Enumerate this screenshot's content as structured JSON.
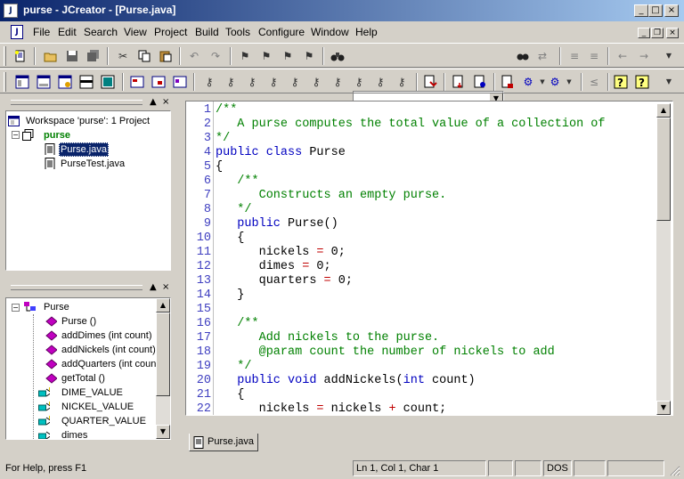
{
  "window": {
    "title": "purse - JCreator - [Purse.java]",
    "app_icon": "J",
    "buttons": {
      "minimize": "_",
      "maximize": "□",
      "close": "×"
    }
  },
  "menu": {
    "doc_icon": "J",
    "items": [
      "File",
      "Edit",
      "Search",
      "View",
      "Project",
      "Build",
      "Tools",
      "Configure",
      "Window",
      "Help"
    ],
    "mdi_buttons": {
      "minimize": "_",
      "restore": "❐",
      "close": "×"
    }
  },
  "toolbar": {
    "find_value": ""
  },
  "workspace_pane": {
    "close": "×",
    "pin": "▲",
    "items": [
      {
        "label": "Workspace 'purse': 1 Project",
        "icon": "workspace-icon"
      },
      {
        "label": "purse",
        "icon": "project-icon",
        "expander": "−"
      },
      {
        "label": "Purse.java",
        "icon": "java-file-icon"
      },
      {
        "label": "PurseTest.java",
        "icon": "java-file-icon"
      }
    ]
  },
  "class_pane": {
    "close": "×",
    "pin": "▲",
    "items": [
      {
        "label": "Purse",
        "icon": "class-icon",
        "expander": "−"
      },
      {
        "label": "Purse ()",
        "icon": "method-icon"
      },
      {
        "label": "addDimes (int count)",
        "icon": "method-icon"
      },
      {
        "label": "addNickels (int count)",
        "icon": "method-icon"
      },
      {
        "label": "addQuarters (int count",
        "icon": "method-icon"
      },
      {
        "label": "getTotal ()",
        "icon": "method-icon"
      },
      {
        "label": "DIME_VALUE",
        "icon": "field-icon"
      },
      {
        "label": "NICKEL_VALUE",
        "icon": "field-icon"
      },
      {
        "label": "QUARTER_VALUE",
        "icon": "field-icon"
      },
      {
        "label": "dimes",
        "icon": "field-icon"
      }
    ]
  },
  "editor": {
    "tab": "Purse.java",
    "lines": [
      {
        "n": "1",
        "segs": [
          [
            "cm",
            "/**"
          ]
        ]
      },
      {
        "n": "2",
        "segs": [
          [
            "cm",
            "   A purse computes the total value of a collection of"
          ]
        ]
      },
      {
        "n": "3",
        "segs": [
          [
            "cm",
            "*/"
          ]
        ]
      },
      {
        "n": "4",
        "segs": [
          [
            "kw",
            "public class"
          ],
          [
            "",
            " Purse"
          ]
        ]
      },
      {
        "n": "5",
        "segs": [
          [
            "",
            "{"
          ]
        ]
      },
      {
        "n": "6",
        "segs": [
          [
            "cm",
            "   /**"
          ]
        ]
      },
      {
        "n": "7",
        "segs": [
          [
            "cm",
            "      Constructs an empty purse."
          ]
        ]
      },
      {
        "n": "8",
        "segs": [
          [
            "cm",
            "   */"
          ]
        ]
      },
      {
        "n": "9",
        "segs": [
          [
            "kw",
            "   public"
          ],
          [
            "",
            " Purse()"
          ]
        ]
      },
      {
        "n": "10",
        "segs": [
          [
            "",
            "   {"
          ]
        ]
      },
      {
        "n": "11",
        "segs": [
          [
            "",
            "      nickels "
          ],
          [
            "op",
            "="
          ],
          [
            "",
            " 0;"
          ]
        ]
      },
      {
        "n": "12",
        "segs": [
          [
            "",
            "      dimes "
          ],
          [
            "op",
            "="
          ],
          [
            "",
            " 0;"
          ]
        ]
      },
      {
        "n": "13",
        "segs": [
          [
            "",
            "      quarters "
          ],
          [
            "op",
            "="
          ],
          [
            "",
            " 0;"
          ]
        ]
      },
      {
        "n": "14",
        "segs": [
          [
            "",
            "   }"
          ]
        ]
      },
      {
        "n": "15",
        "segs": []
      },
      {
        "n": "16",
        "segs": [
          [
            "cm",
            "   /**"
          ]
        ]
      },
      {
        "n": "17",
        "segs": [
          [
            "cm",
            "      Add nickels to the purse."
          ]
        ]
      },
      {
        "n": "18",
        "segs": [
          [
            "cm",
            "      @param count the number of nickels to add"
          ]
        ]
      },
      {
        "n": "19",
        "segs": [
          [
            "cm",
            "   */"
          ]
        ]
      },
      {
        "n": "20",
        "segs": [
          [
            "kw",
            "   public void"
          ],
          [
            "",
            " addNickels("
          ],
          [
            "kw",
            "int"
          ],
          [
            "",
            " count)"
          ]
        ]
      },
      {
        "n": "21",
        "segs": [
          [
            "",
            "   {"
          ]
        ]
      },
      {
        "n": "22",
        "segs": [
          [
            "",
            "      nickels "
          ],
          [
            "op",
            "="
          ],
          [
            "",
            " nickels "
          ],
          [
            "op",
            "+"
          ],
          [
            "",
            " count;"
          ]
        ]
      }
    ]
  },
  "status": {
    "help": "For Help, press F1",
    "position": "Ln 1, Col 1, Char 1",
    "format": "DOS"
  },
  "colors": {
    "title_start": "#0a246a",
    "title_end": "#a6caf0",
    "comment": "#008000",
    "keyword": "#0000c0",
    "line_number": "#4040c0"
  }
}
